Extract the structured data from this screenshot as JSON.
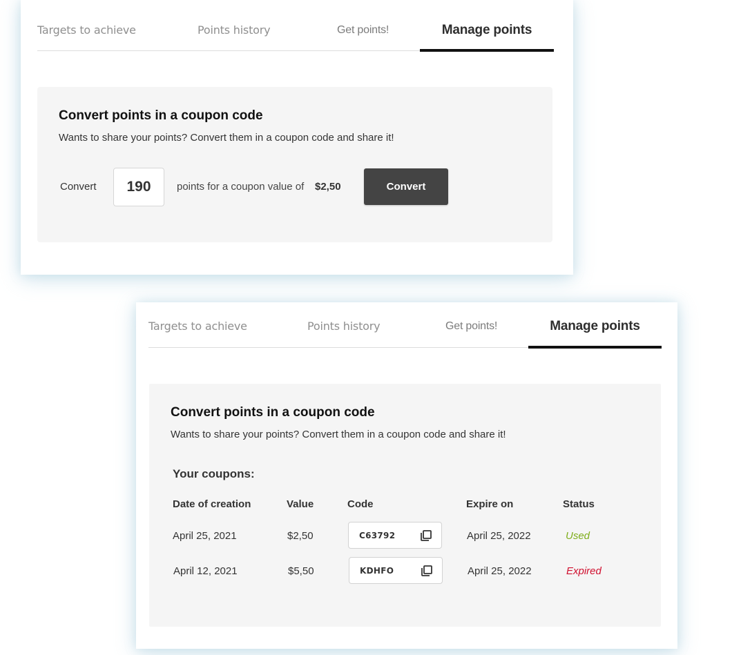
{
  "colors": {
    "active_tab_underline": "#111111",
    "convert_button_bg": "#444444",
    "panel_bg": "#f5f5f5",
    "status_used": "#7fae1b",
    "status_expired": "#d0102f"
  },
  "cards": [
    {
      "tabs": [
        {
          "label": "Targets to achieve",
          "active": false
        },
        {
          "label": "Points history",
          "active": false
        },
        {
          "label": "Get points!",
          "active": false
        },
        {
          "label": "Manage points",
          "active": true
        }
      ],
      "panel": {
        "title": "Convert points in a coupon code",
        "subtitle": "Wants to share your points? Convert them in a coupon code and share it!",
        "convert_label": "Convert",
        "points_value": "190",
        "description": "points for a coupon value of",
        "coupon_value": "$2,50",
        "button_label": "Convert"
      }
    },
    {
      "tabs": [
        {
          "label": "Targets to achieve",
          "active": false
        },
        {
          "label": "Points history",
          "active": false
        },
        {
          "label": "Get points!",
          "active": false
        },
        {
          "label": "Manage points",
          "active": true
        }
      ],
      "panel": {
        "title": "Convert points in a coupon code",
        "subtitle": "Wants to share your points? Convert them in a coupon code and share it!",
        "coupons_title": "Your coupons:",
        "columns": [
          "Date of creation",
          "Value",
          "Code",
          "Expire on",
          "Status"
        ],
        "coupons": [
          {
            "date": "April 25, 2021",
            "value": "$2,50",
            "code": "C63792",
            "code_icon": "copy-icon",
            "expire": "April 25, 2022",
            "status": "Used"
          },
          {
            "date": "April 12, 2021",
            "value": "$5,50",
            "code": "KDHFO",
            "code_icon": "copy-icon",
            "expire": "April 25, 2022",
            "status": "Expired"
          }
        ]
      }
    }
  ]
}
